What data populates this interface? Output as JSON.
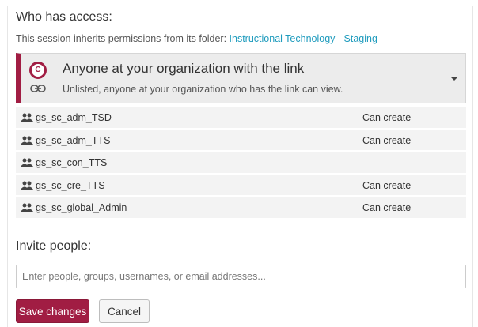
{
  "access": {
    "title": "Who has access:",
    "inherit_prefix": "This session inherits permissions from its folder: ",
    "folder_link": "Instructional Technology - Staging"
  },
  "share_setting": {
    "title": "Anyone at your organization with the link",
    "description": "Unlisted, anyone at your organization who has the link can view.",
    "org_icon": "organization-logo-icon",
    "link_icon": "link-icon",
    "dropdown_icon": "caret-down-icon"
  },
  "members": [
    {
      "name": "gs_sc_adm_TSD",
      "permission": "Can create"
    },
    {
      "name": "gs_sc_adm_TTS",
      "permission": "Can create"
    },
    {
      "name": "gs_sc_con_TTS",
      "permission": ""
    },
    {
      "name": "gs_sc_cre_TTS",
      "permission": "Can create"
    },
    {
      "name": "gs_sc_global_Admin",
      "permission": "Can create"
    }
  ],
  "invite": {
    "title": "Invite people:",
    "placeholder": "Enter people, groups, usernames, or email addresses...",
    "value": ""
  },
  "buttons": {
    "save": "Save changes",
    "cancel": "Cancel"
  },
  "colors": {
    "accent": "#a11d43",
    "link": "#1e9bbd",
    "row_bg": "#f3f3f3",
    "share_bg": "#ececec"
  }
}
